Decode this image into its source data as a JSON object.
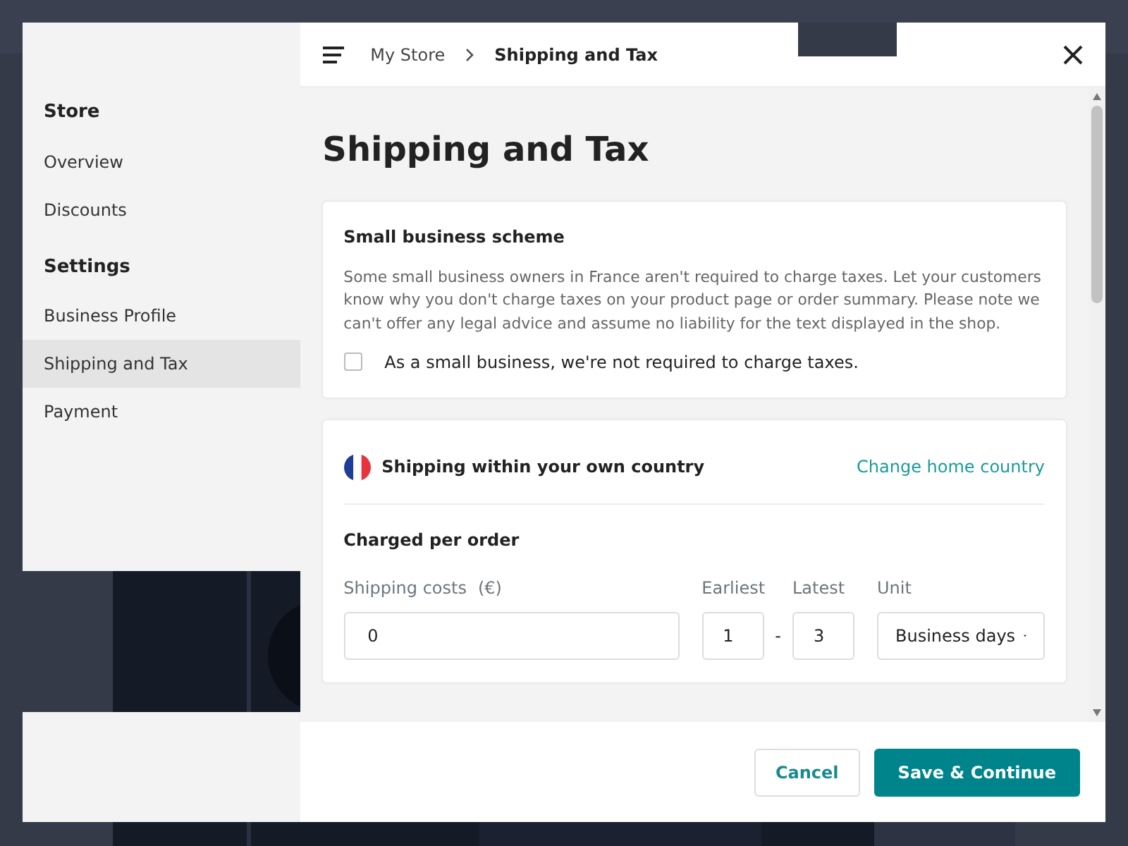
{
  "sidebar": {
    "sections": [
      {
        "heading": "Store",
        "items": [
          {
            "label": "Overview",
            "selected": false
          },
          {
            "label": "Discounts",
            "selected": false
          }
        ]
      },
      {
        "heading": "Settings",
        "items": [
          {
            "label": "Business Profile",
            "selected": false
          },
          {
            "label": "Shipping and Tax",
            "selected": true
          },
          {
            "label": "Payment",
            "selected": false
          }
        ]
      }
    ]
  },
  "breadcrumb": [
    "My Store",
    "Shipping and Tax"
  ],
  "title": "Shipping and Tax",
  "small_business": {
    "heading": "Small business scheme",
    "text": "Some small business owners in France aren't required to charge taxes. Let your customers know why you don't charge taxes on your product page or order summary. Please note we can't offer any legal advice and assume no liability for the text displayed in the shop.",
    "checkbox": {
      "label": "As a small business, we're not required to charge taxes.",
      "checked": false
    }
  },
  "domestic": {
    "heading": "Shipping within your own country",
    "link": "Change home country",
    "subheading": "Charged per order",
    "fields": [
      {
        "kind": "text",
        "label": "Shipping costs",
        "hint": "(€)",
        "value": "0"
      },
      {
        "kind": "number",
        "label": "Earliest",
        "value": "1"
      },
      {
        "kind": "separator",
        "label": "-"
      },
      {
        "kind": "number",
        "label": "Latest",
        "value": "3"
      },
      {
        "kind": "select",
        "label": "Unit",
        "value": "Business days"
      }
    ]
  },
  "buttons": [
    {
      "label": "Cancel",
      "kind": "secondary"
    },
    {
      "label": "Save & Continue",
      "kind": "primary"
    }
  ]
}
